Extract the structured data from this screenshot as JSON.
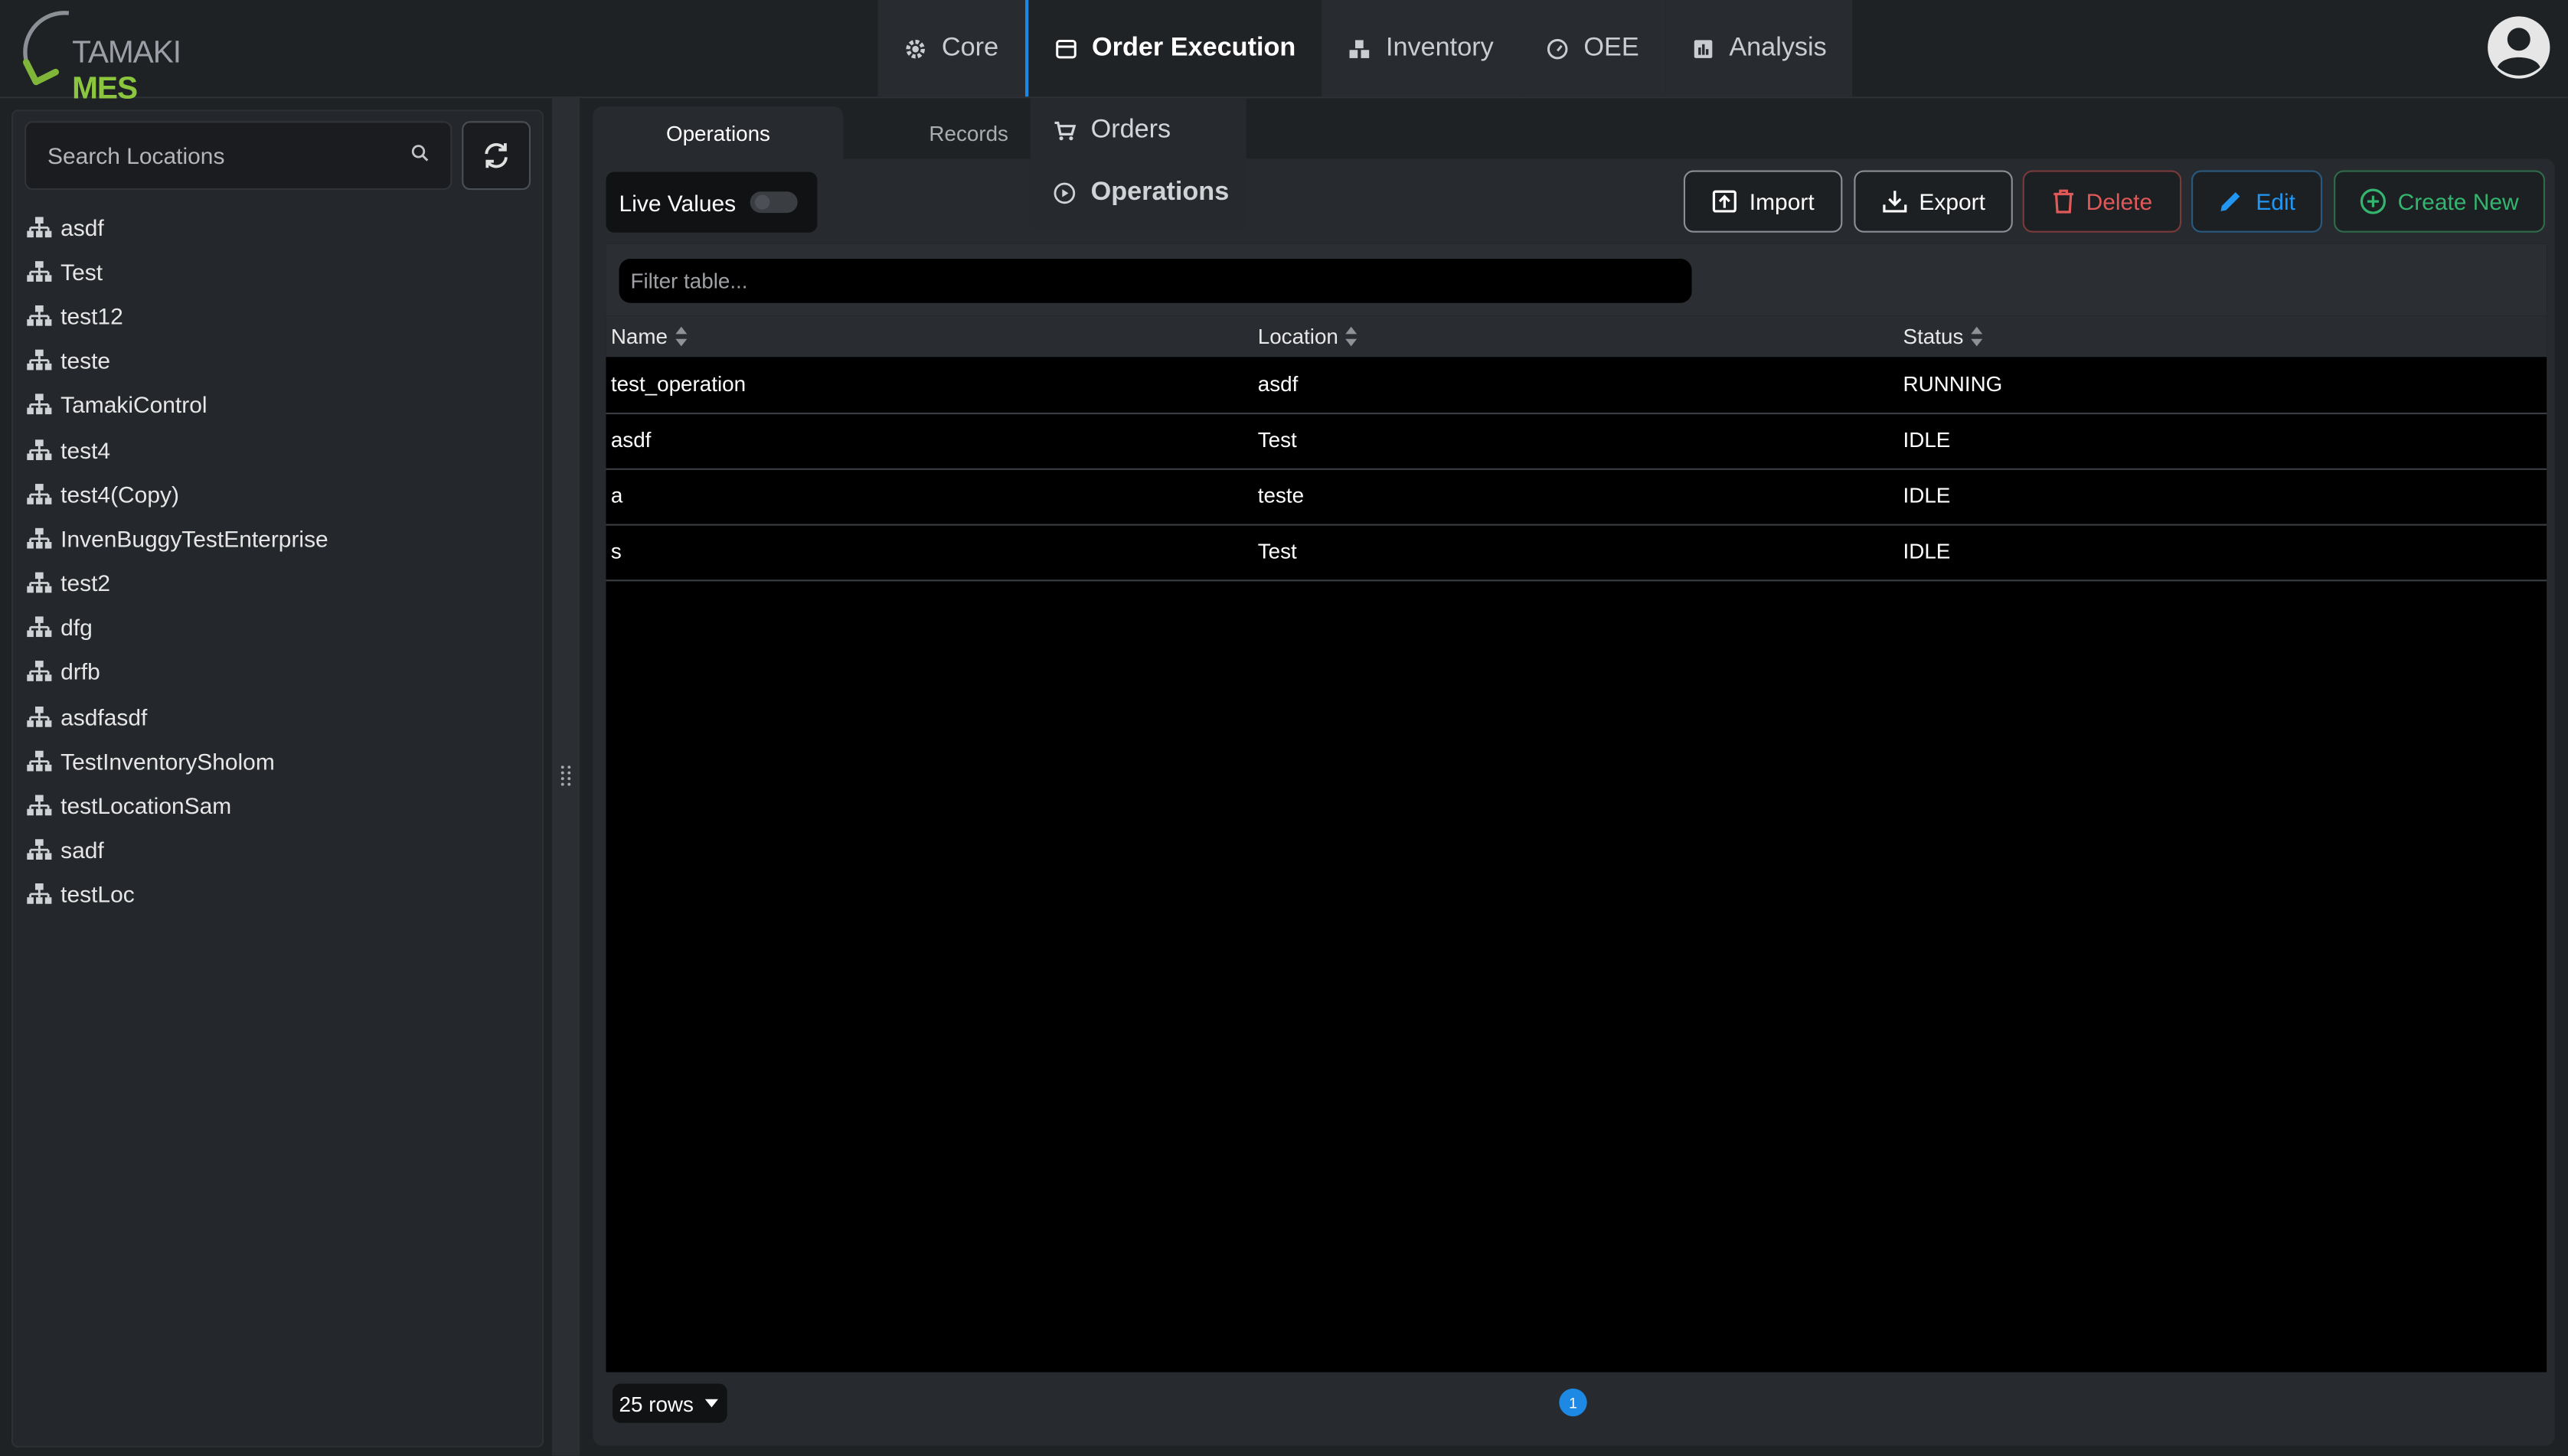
{
  "brand": {
    "word1": "TAMAKI",
    "word2": "MES",
    "accent": "#8cc63f"
  },
  "nav": {
    "items": [
      {
        "label": "Core",
        "icon": "gear-icon"
      },
      {
        "label": "Order Execution",
        "icon": "store-icon"
      },
      {
        "label": "Inventory",
        "icon": "boxes-icon"
      },
      {
        "label": "OEE",
        "icon": "gauge-icon"
      },
      {
        "label": "Analysis",
        "icon": "chart-icon"
      }
    ],
    "active": "Order Execution"
  },
  "dropdown": {
    "items": [
      {
        "label": "Orders",
        "icon": "cart-icon"
      },
      {
        "label": "Operations",
        "icon": "play-circle-icon"
      }
    ]
  },
  "sidebar": {
    "search_placeholder": "Search Locations",
    "locations": [
      "asdf",
      "Test",
      "test12",
      "teste",
      "TamakiControl",
      "test4",
      "test4(Copy)",
      "InvenBuggyTestEnterprise",
      "test2",
      "dfg",
      "drfb",
      "asdfasdf",
      "TestInventorySholom",
      "testLocationSam",
      "sadf",
      "testLoc"
    ]
  },
  "tabs": {
    "operations": "Operations",
    "records": "Records"
  },
  "toolbar": {
    "live_values": "Live Values",
    "import": "Import",
    "export": "Export",
    "delete": "Delete",
    "edit": "Edit",
    "create_new": "Create New",
    "colors": {
      "delete": "#e05858",
      "edit": "#2196f3",
      "create": "#34b56f"
    }
  },
  "table": {
    "filter_placeholder": "Filter table...",
    "columns": [
      "Name",
      "Location",
      "Status"
    ],
    "rows": [
      [
        "test_operation",
        "asdf",
        "RUNNING"
      ],
      [
        "asdf",
        "Test",
        "IDLE"
      ],
      [
        "a",
        "teste",
        "IDLE"
      ],
      [
        "s",
        "Test",
        "IDLE"
      ]
    ]
  },
  "pager": {
    "rows_label": "25 rows",
    "page": "1"
  }
}
